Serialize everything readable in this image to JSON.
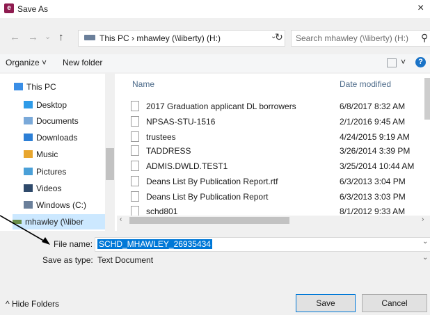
{
  "titlebar": {
    "app_icon_letter": "e",
    "title": "Save As",
    "close_glyph": "×"
  },
  "navigation": {
    "back_glyph": "←",
    "forward_glyph": "→",
    "recent_glyph": "⌄",
    "up_glyph": "↑",
    "address_path": "This PC  ›  mhawley (\\\\liberty) (H:)",
    "address_prefix": "›",
    "dropdown_glyph": "⌄",
    "refresh_glyph": "↻",
    "search_placeholder": "Search mhawley (\\\\liberty) (H:)",
    "search_glyph": "⚲"
  },
  "commandbar": {
    "organize_label": "Organize ˅",
    "new_folder_label": "New folder",
    "view_menu_glyph": "˅",
    "help_glyph": "?"
  },
  "nav_pane": {
    "items": [
      {
        "label": "This PC",
        "icon": "this-pc-icon",
        "color": "#3a8ee6"
      },
      {
        "label": "Desktop",
        "icon": "desktop-folder-icon",
        "color": "#2e9be8"
      },
      {
        "label": "Documents",
        "icon": "documents-folder-icon",
        "color": "#7aa9d9"
      },
      {
        "label": "Downloads",
        "icon": "downloads-folder-icon",
        "color": "#2c7fd6"
      },
      {
        "label": "Music",
        "icon": "music-folder-icon",
        "color": "#e8a62e"
      },
      {
        "label": "Pictures",
        "icon": "pictures-folder-icon",
        "color": "#4aa0d8"
      },
      {
        "label": "Videos",
        "icon": "videos-folder-icon",
        "color": "#2f4a6b"
      },
      {
        "label": "Windows (C:)",
        "icon": "drive-icon",
        "color": "#6a7f9a"
      },
      {
        "label": "mhawley (\\\\liber",
        "icon": "network-drive-icon",
        "color": "#6a8f4a"
      }
    ]
  },
  "file_list": {
    "columns": {
      "name": "Name",
      "date": "Date modified"
    },
    "rows": [
      {
        "name": "2017 Graduation applicant DL borrowers",
        "date": "6/8/2017 8:32 AM"
      },
      {
        "name": "NPSAS-STU-1516",
        "date": "2/1/2016 9:45 AM"
      },
      {
        "name": "trustees",
        "date": "4/24/2015 9:19 AM"
      },
      {
        "name": "TADDRESS",
        "date": "3/26/2014 3:39 PM"
      },
      {
        "name": "ADMIS.DWLD.TEST1",
        "date": "3/25/2014 10:44 AM"
      },
      {
        "name": "Deans List By Publication Report.rtf",
        "date": "6/3/2013 3:04 PM"
      },
      {
        "name": "Deans List By Publication Report",
        "date": "6/3/2013 3:03 PM"
      },
      {
        "name": "schd801",
        "date": "8/1/2012 9:33 AM"
      }
    ]
  },
  "form": {
    "file_name_label": "File name:",
    "file_name_value": "SCHD_MHAWLEY_26935434",
    "save_as_type_label": "Save as type:",
    "save_as_type_value": "Text Document"
  },
  "footer": {
    "hide_folders_label": "Hide Folders",
    "hide_folders_glyph": "^",
    "save_label": "Save",
    "cancel_label": "Cancel"
  },
  "colors": {
    "accent": "#0078d7",
    "selection_text": "#ffffff",
    "app_icon": "#8e1b4f",
    "help_icon": "#1a73c7"
  }
}
